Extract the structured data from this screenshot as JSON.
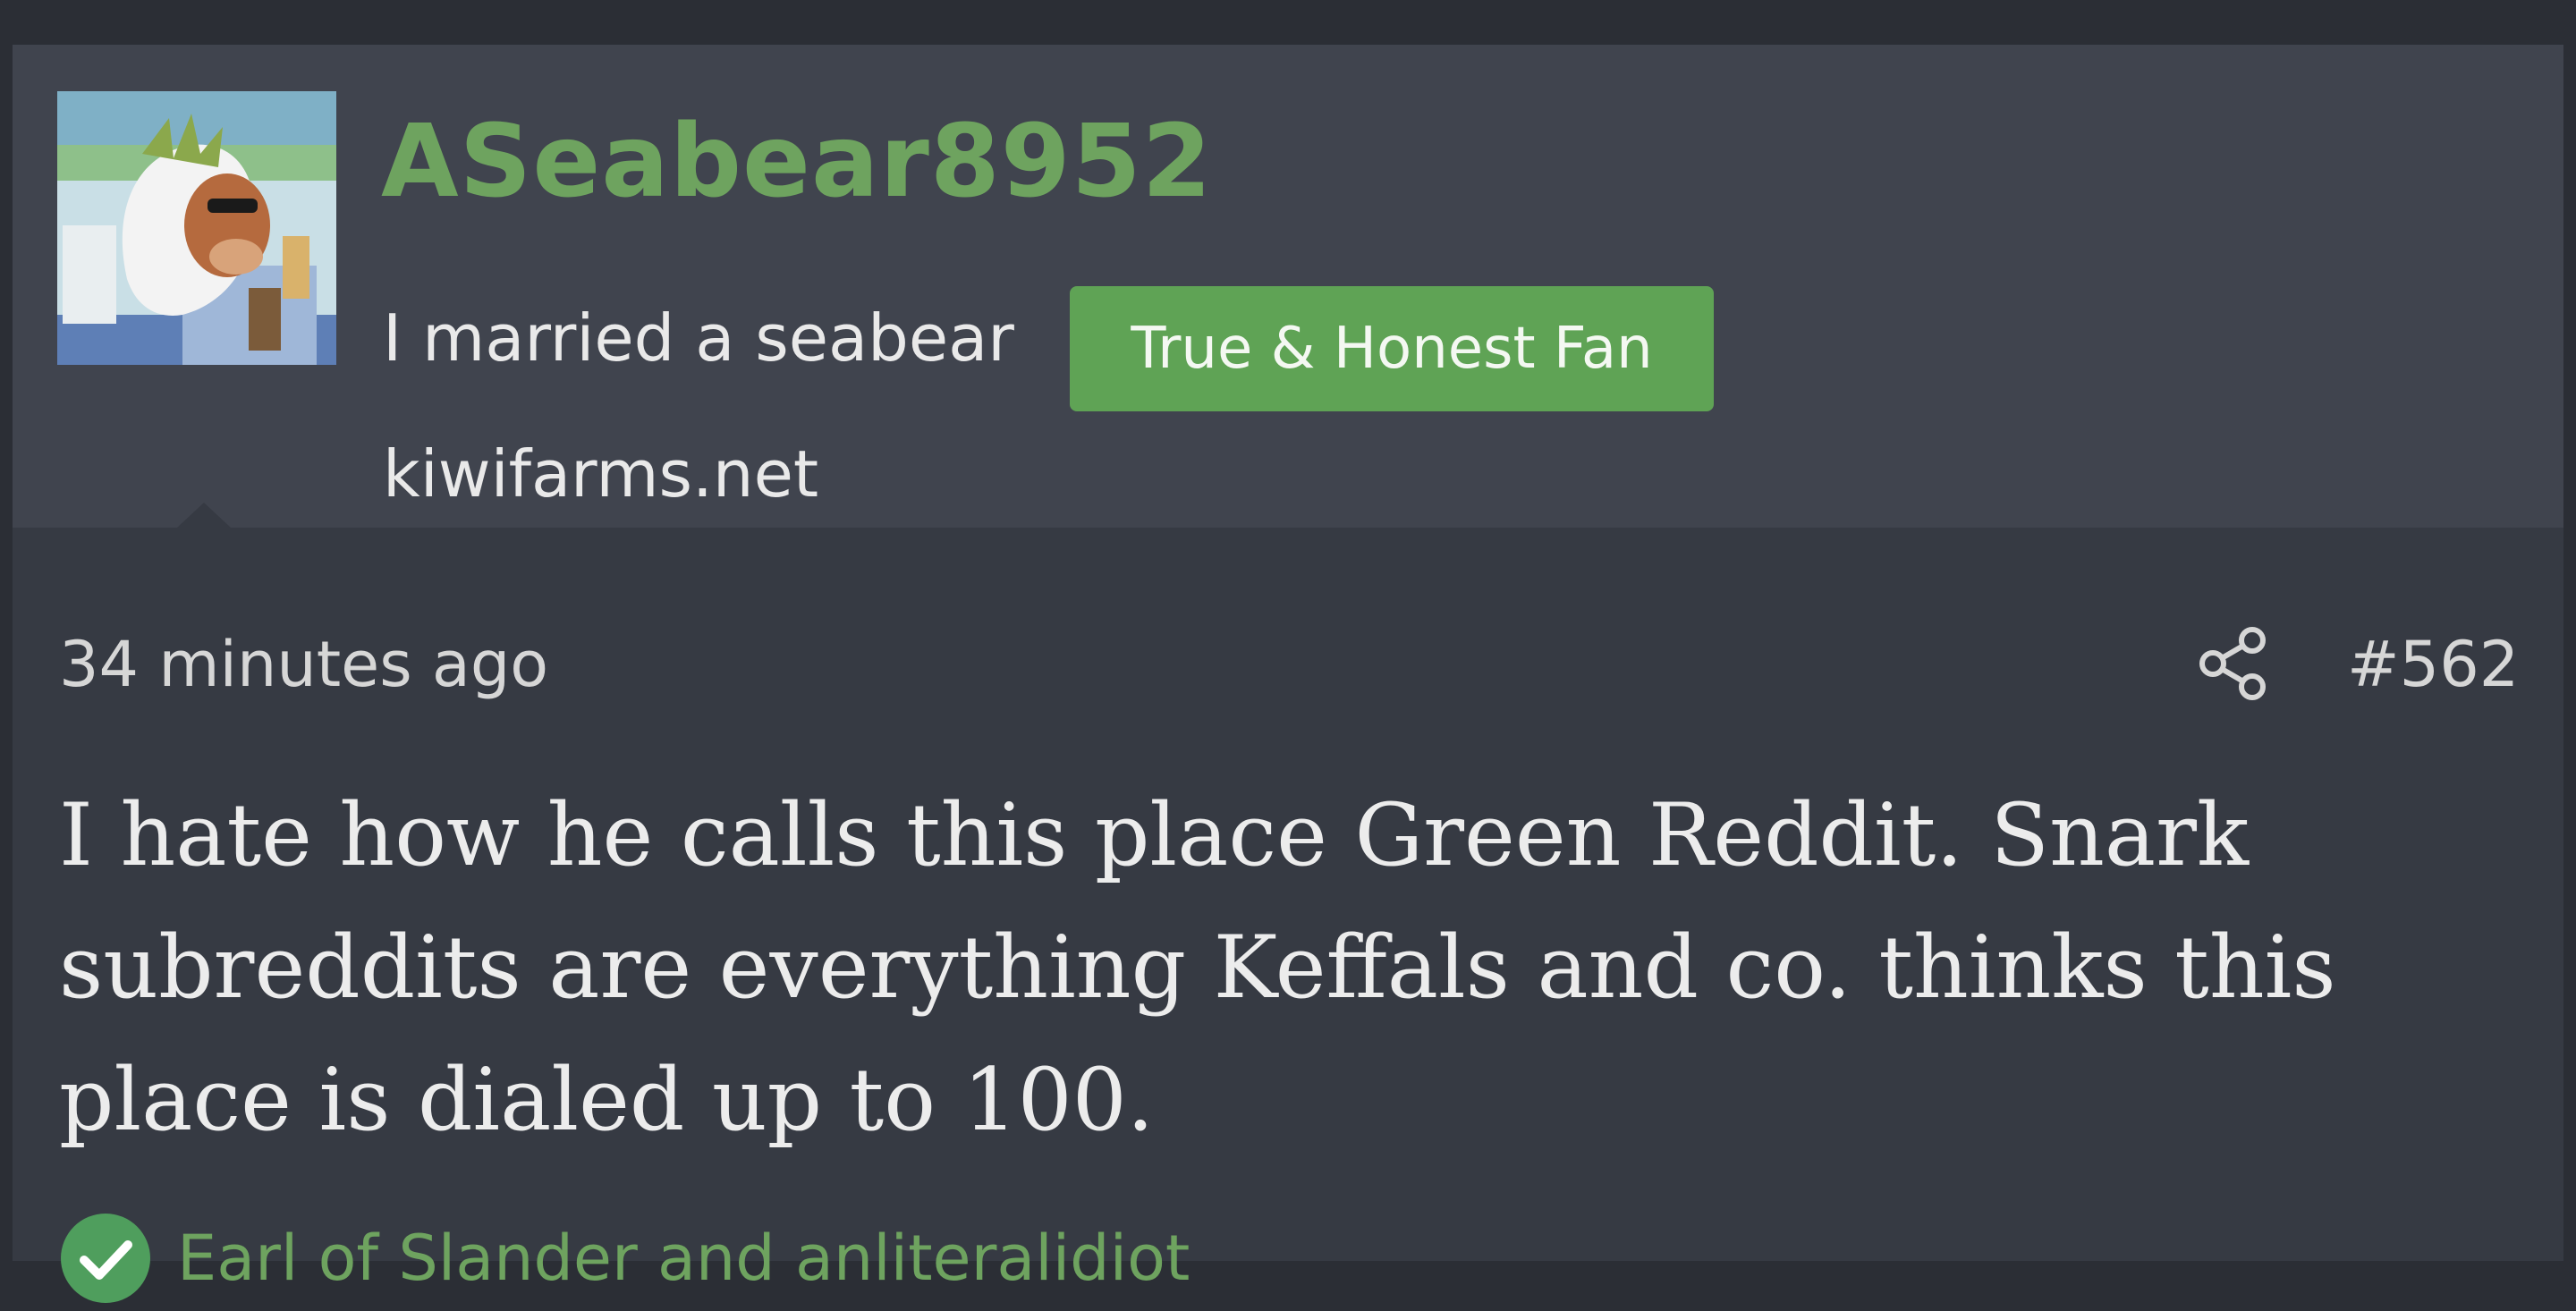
{
  "post": {
    "author": {
      "username": "ASeabear8952",
      "title": "I married a seabear",
      "banner": "True & Honest Fan",
      "website": "kiwifarms.net",
      "avatar_icon": "cartoon-character-avatar"
    },
    "date": "34 minutes ago",
    "number": "#562",
    "share_icon": "share-icon",
    "body": "I hate how he calls this place Green Reddit. Snark subreddits are everything Keffals and co. thinks this place is dialed up to 100.",
    "reactions": {
      "icon": "checkmark-icon",
      "users": "Earl of Slander and anliteralidiot"
    }
  },
  "colors": {
    "page_background": "#2b2e35",
    "post_background": "#363a43",
    "header_background": "#40444e",
    "username": "#6ea35f",
    "banner_background": "#5fa355",
    "reaction_green": "#4f9e5d",
    "text": "#ececec"
  }
}
